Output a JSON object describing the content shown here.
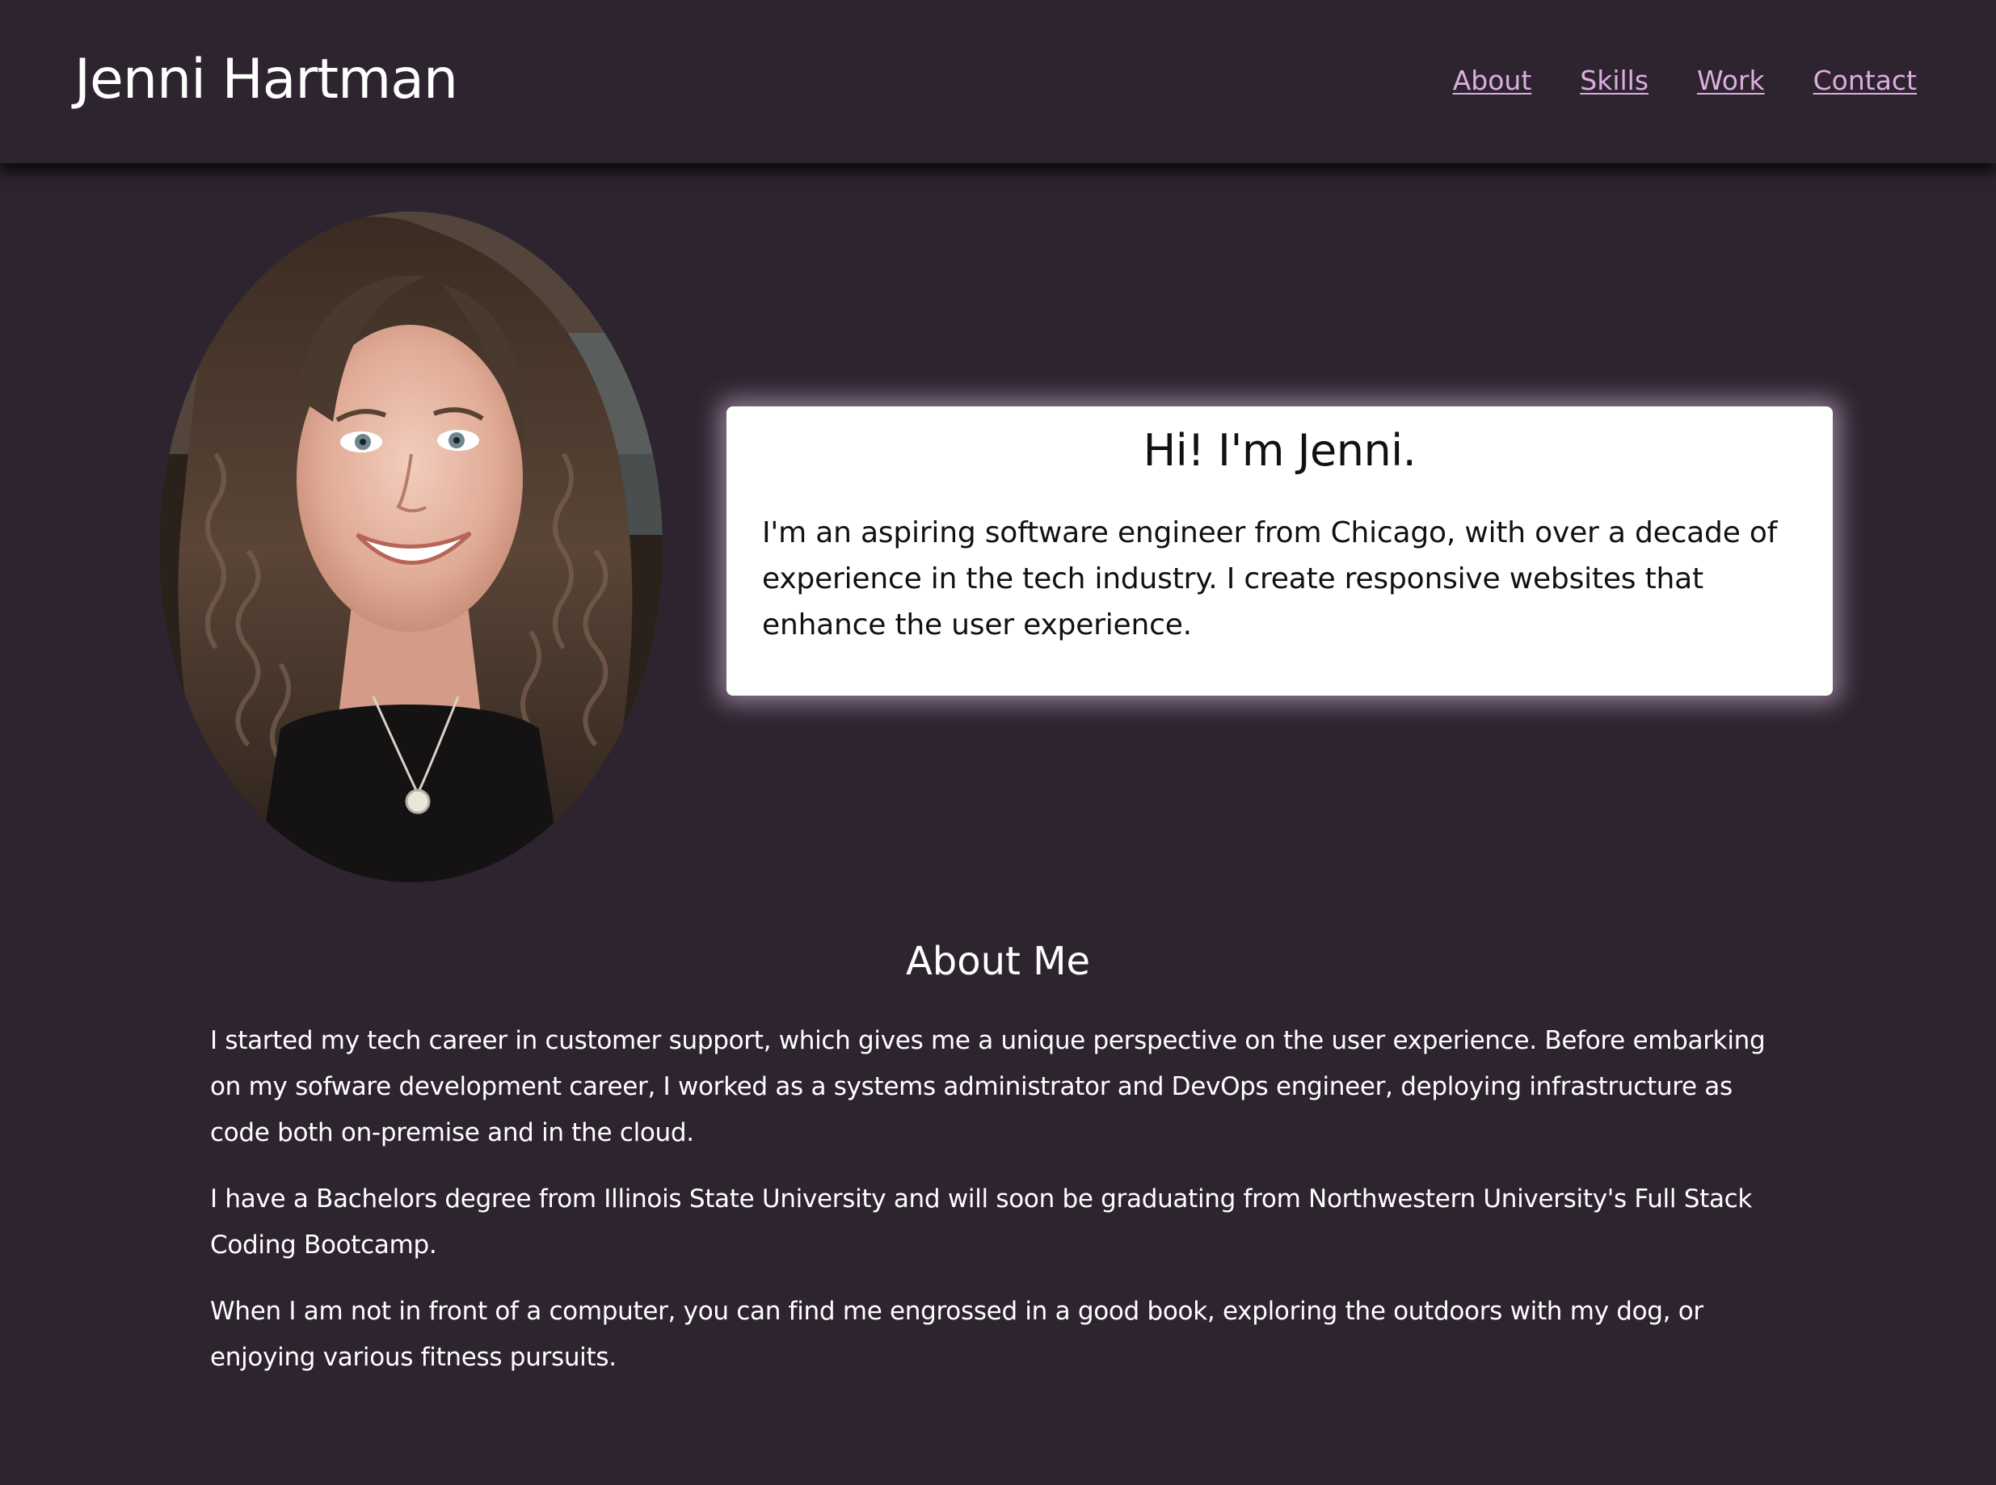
{
  "header": {
    "title": "Jenni Hartman",
    "nav": [
      {
        "label": "About"
      },
      {
        "label": "Skills"
      },
      {
        "label": "Work"
      },
      {
        "label": "Contact"
      }
    ]
  },
  "hero": {
    "photo_alt": "profile-photo",
    "heading": "Hi! I'm Jenni.",
    "text": "I'm an aspiring software engineer from Chicago, with over a decade of experience in the tech industry. I create responsive websites that enhance the user experience."
  },
  "about": {
    "heading": "About Me",
    "paragraphs": [
      "I started my tech career in customer support, which gives me a unique perspective on the user experience. Before embarking on my sofware development career, I worked as a systems administrator and DevOps engineer, deploying infrastructure as code both on-premise and in the cloud.",
      "I have a Bachelors degree from Illinois State University and will soon be graduating from Northwestern University's Full Stack Coding Bootcamp.",
      "When I am not in front of a computer, you can find me engrossed in a good book, exploring the outdoors with my dog, or enjoying various fitness pursuits."
    ]
  },
  "colors": {
    "background": "#2e2430",
    "nav_link": "#dcaede",
    "card": "#ffffff",
    "card_glow": "#d6bcdc"
  }
}
